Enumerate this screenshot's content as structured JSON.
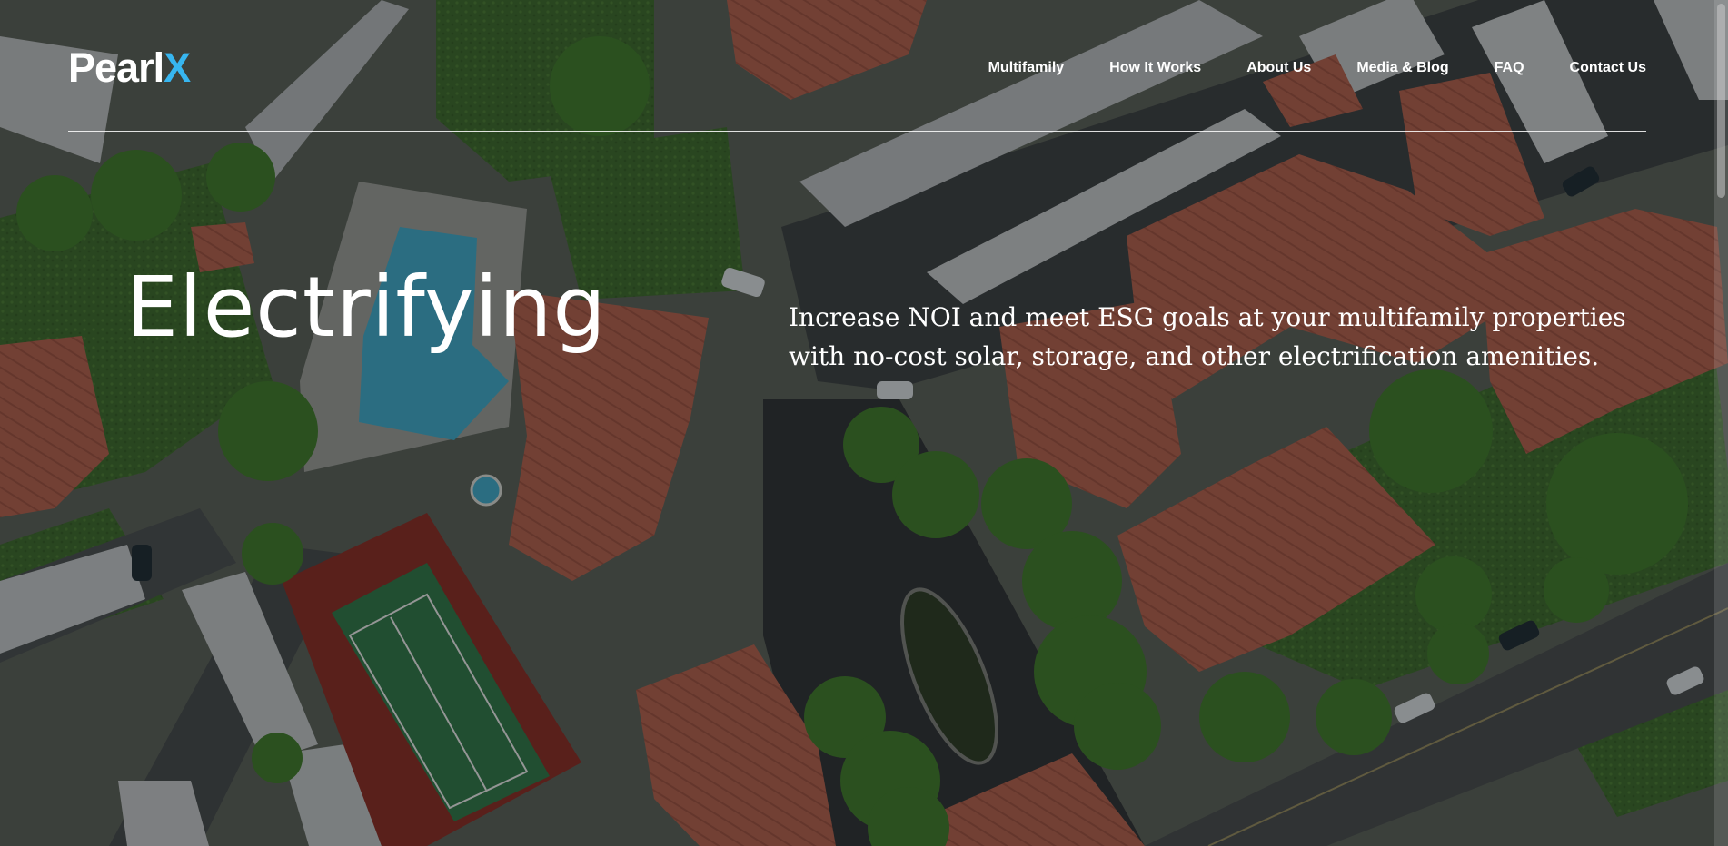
{
  "brand": {
    "logo_main": "Pearl",
    "logo_accent": "X",
    "accent_color": "#37b6f0"
  },
  "nav": {
    "items": [
      {
        "label": "Multifamily"
      },
      {
        "label": "How It Works"
      },
      {
        "label": "About Us"
      },
      {
        "label": "Media & Blog"
      },
      {
        "label": "FAQ"
      },
      {
        "label": "Contact Us"
      }
    ]
  },
  "hero": {
    "headline": "Electrifying",
    "subcopy": "Increase NOI and meet ESG goals at your multifamily properties with no-cost solar, storage, and other electrification amenities."
  },
  "background": {
    "description_icon": "aerial-photo-image"
  }
}
